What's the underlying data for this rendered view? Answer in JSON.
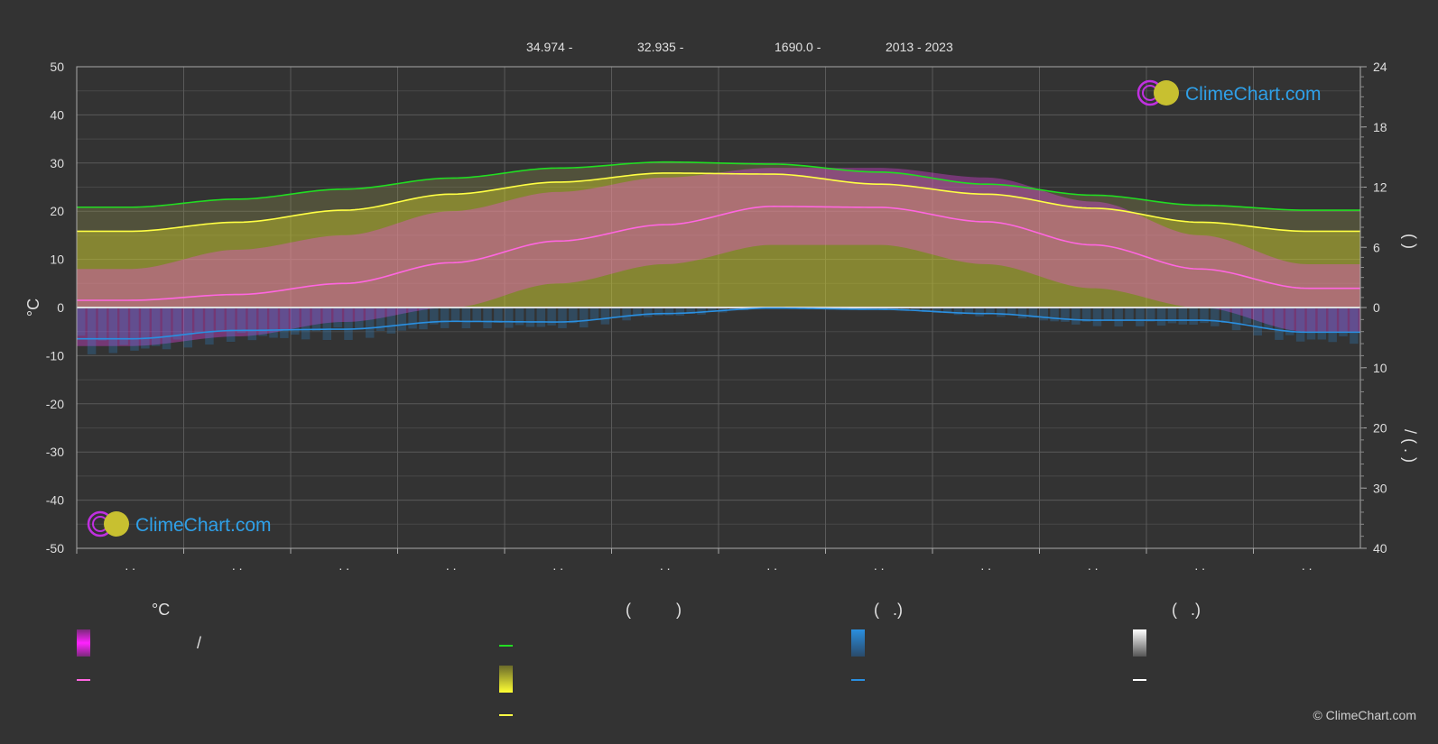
{
  "header": {
    "items": [
      "34.974 -",
      "32.935 -",
      "1690.0 -",
      "2013 - 2023"
    ]
  },
  "brand": {
    "name": "ClimeChart.com"
  },
  "copyright": "© ClimeChart.com",
  "legend": {
    "col1": {
      "heading": "°C",
      "bar_label": "/",
      "line_label": ""
    },
    "col2": {
      "heading": "(          )",
      "line1_label": "",
      "bar_label": "",
      "line2_label": ""
    },
    "col3": {
      "heading": "(   .)",
      "bar_label": "",
      "line_label": ""
    },
    "col4": {
      "heading": "(   .)",
      "bar_label": "",
      "line_label": ""
    }
  },
  "colors": {
    "background": "#333333",
    "daylight_line": "#22dd22",
    "sunshine_line": "#ffff44",
    "avg_temp_line": "#ff66e0",
    "rain_line": "#2a8fe0",
    "snow_line": "#ffffff",
    "temp_band": "#ff44ff",
    "sunshine_band": "#c8c832",
    "rain_band": "#2a8fe0"
  },
  "chart_data": {
    "type": "line",
    "categories": [
      ". .",
      ". .",
      ". .",
      ". .",
      ". .",
      ". .",
      ". .",
      ". .",
      ". .",
      ". .",
      ". .",
      ". ."
    ],
    "left_axis": {
      "label": "°C",
      "range": [
        -50,
        50
      ],
      "ticks": [
        50,
        40,
        30,
        20,
        10,
        0,
        -10,
        -20,
        -30,
        -40,
        -50
      ]
    },
    "right_axis_top": {
      "label": "(   )",
      "range": [
        0,
        24
      ],
      "ticks": [
        24,
        18,
        12,
        6,
        0
      ]
    },
    "right_axis_bottom": {
      "label": "/   ( . )",
      "range": [
        0,
        40
      ],
      "ticks": [
        0,
        10,
        20,
        30,
        40
      ]
    },
    "grid": true,
    "series": [
      {
        "key": "daylight",
        "axis": "right_top",
        "values": [
          10.0,
          10.8,
          11.8,
          12.9,
          13.9,
          14.5,
          14.3,
          13.5,
          12.3,
          11.2,
          10.2,
          9.7
        ]
      },
      {
        "key": "sunshine",
        "axis": "right_top",
        "values": [
          7.6,
          8.5,
          9.7,
          11.3,
          12.5,
          13.4,
          13.3,
          12.3,
          11.3,
          9.9,
          8.5,
          7.6
        ]
      },
      {
        "key": "avg_temp",
        "axis": "left",
        "values": [
          1.5,
          2.7,
          5.0,
          9.3,
          13.8,
          17.2,
          21.0,
          20.8,
          17.8,
          13.0,
          8.0,
          4.0
        ]
      },
      {
        "key": "rain",
        "axis": "right_bottom",
        "values": [
          5.2,
          3.8,
          3.6,
          2.3,
          2.4,
          1.0,
          0.1,
          0.3,
          1.0,
          2.1,
          2.1,
          4.1
        ]
      },
      {
        "key": "temp_max_band",
        "axis": "left",
        "values": [
          8,
          12,
          15,
          20,
          24,
          27,
          29,
          29,
          27,
          22,
          15,
          9
        ]
      },
      {
        "key": "temp_min_band",
        "axis": "left",
        "values": [
          -8,
          -6,
          -3,
          0,
          5,
          9,
          13,
          13,
          9,
          4,
          0,
          -5
        ]
      }
    ]
  }
}
